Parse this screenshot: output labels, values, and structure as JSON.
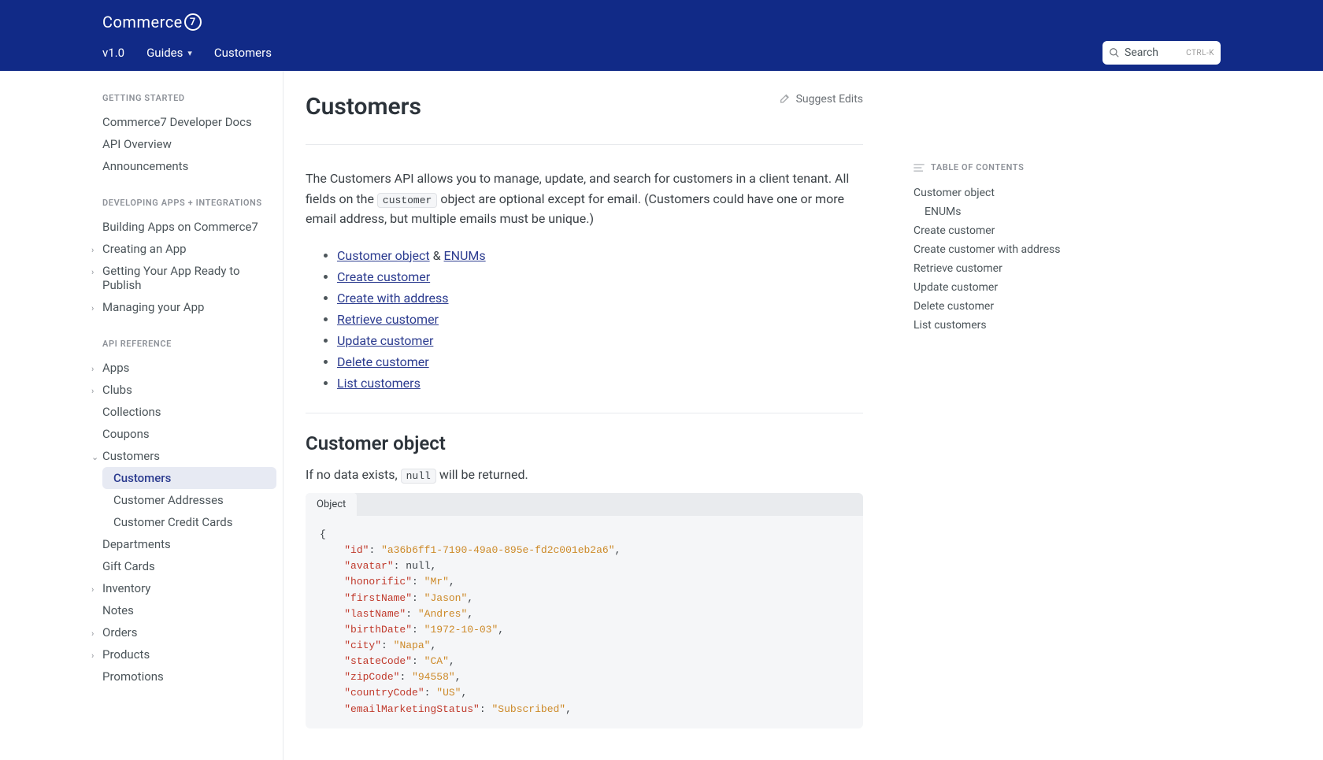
{
  "header": {
    "logo": "Commerce",
    "nav": {
      "version": "v1.0",
      "guides": "Guides",
      "customers": "Customers"
    },
    "search": {
      "placeholder": "Search",
      "shortcut": "CTRL-K"
    }
  },
  "sidebar": {
    "sections": [
      {
        "title": "GETTING STARTED",
        "items": [
          {
            "label": "Commerce7 Developer Docs"
          },
          {
            "label": "API Overview"
          },
          {
            "label": "Announcements"
          }
        ]
      },
      {
        "title": "DEVELOPING APPS + INTEGRATIONS",
        "items": [
          {
            "label": "Building Apps on Commerce7"
          },
          {
            "label": "Creating an App",
            "expandable": true
          },
          {
            "label": "Getting Your App Ready to Publish",
            "expandable": true
          },
          {
            "label": "Managing your App",
            "expandable": true
          }
        ]
      },
      {
        "title": "API REFERENCE",
        "items": [
          {
            "label": "Apps",
            "expandable": true
          },
          {
            "label": "Clubs",
            "expandable": true
          },
          {
            "label": "Collections"
          },
          {
            "label": "Coupons"
          },
          {
            "label": "Customers",
            "expandable": true,
            "expanded": true,
            "children": [
              {
                "label": "Customers",
                "active": true
              },
              {
                "label": "Customer Addresses"
              },
              {
                "label": "Customer Credit Cards"
              }
            ]
          },
          {
            "label": "Departments"
          },
          {
            "label": "Gift Cards"
          },
          {
            "label": "Inventory",
            "expandable": true
          },
          {
            "label": "Notes"
          },
          {
            "label": "Orders",
            "expandable": true
          },
          {
            "label": "Products",
            "expandable": true
          },
          {
            "label": "Promotions"
          }
        ]
      }
    ]
  },
  "content": {
    "title": "Customers",
    "suggest": "Suggest Edits",
    "intro_pre": "The Customers API allows you to manage, update, and search for customers in a client tenant. All fields on the ",
    "intro_code": "customer",
    "intro_post": " object are optional except for email. (Customers could have one or more email address, but multiple emails must be unique.)",
    "quick_links": [
      {
        "label": "Customer object",
        "after_amp": "ENUMs"
      },
      {
        "label": "Create customer"
      },
      {
        "label": "Create with address"
      },
      {
        "label": "Retrieve customer"
      },
      {
        "label": "Update customer"
      },
      {
        "label": "Delete customer"
      },
      {
        "label": "List customers"
      }
    ],
    "section_title": "Customer object",
    "note_pre": "If no data exists, ",
    "note_code": "null",
    "note_post": " will be returned.",
    "code_tab": "Object",
    "code_lines": [
      {
        "type": "open"
      },
      {
        "key": "id",
        "val": "a36b6ff1-7190-49a0-895e-fd2c001eb2a6",
        "str": true
      },
      {
        "key": "avatar",
        "val": "null",
        "null": true
      },
      {
        "key": "honorific",
        "val": "Mr",
        "str": true
      },
      {
        "key": "firstName",
        "val": "Jason",
        "str": true
      },
      {
        "key": "lastName",
        "val": "Andres",
        "str": true
      },
      {
        "key": "birthDate",
        "val": "1972-10-03",
        "str": true
      },
      {
        "key": "city",
        "val": "Napa",
        "str": true
      },
      {
        "key": "stateCode",
        "val": "CA",
        "str": true
      },
      {
        "key": "zipCode",
        "val": "94558",
        "str": true
      },
      {
        "key": "countryCode",
        "val": "US",
        "str": true
      },
      {
        "key": "emailMarketingStatus",
        "val": "Subscribed",
        "str": true,
        "partial": true
      }
    ]
  },
  "toc": {
    "title": "TABLE OF CONTENTS",
    "items": [
      {
        "label": "Customer object"
      },
      {
        "label": "ENUMs",
        "indent": true
      },
      {
        "label": "Create customer"
      },
      {
        "label": "Create customer with address"
      },
      {
        "label": "Retrieve customer"
      },
      {
        "label": "Update customer"
      },
      {
        "label": "Delete customer"
      },
      {
        "label": "List customers"
      }
    ]
  }
}
